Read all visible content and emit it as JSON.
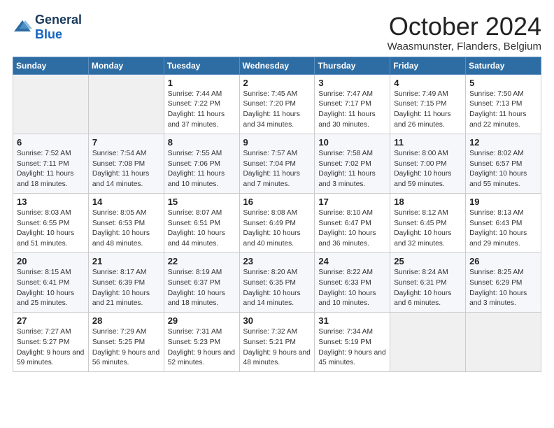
{
  "header": {
    "logo_line1": "General",
    "logo_line2": "Blue",
    "month": "October 2024",
    "location": "Waasmunster, Flanders, Belgium"
  },
  "weekdays": [
    "Sunday",
    "Monday",
    "Tuesday",
    "Wednesday",
    "Thursday",
    "Friday",
    "Saturday"
  ],
  "weeks": [
    [
      {
        "day": "",
        "empty": true
      },
      {
        "day": "",
        "empty": true
      },
      {
        "day": "1",
        "sunrise": "7:44 AM",
        "sunset": "7:22 PM",
        "daylight": "11 hours and 37 minutes."
      },
      {
        "day": "2",
        "sunrise": "7:45 AM",
        "sunset": "7:20 PM",
        "daylight": "11 hours and 34 minutes."
      },
      {
        "day": "3",
        "sunrise": "7:47 AM",
        "sunset": "7:17 PM",
        "daylight": "11 hours and 30 minutes."
      },
      {
        "day": "4",
        "sunrise": "7:49 AM",
        "sunset": "7:15 PM",
        "daylight": "11 hours and 26 minutes."
      },
      {
        "day": "5",
        "sunrise": "7:50 AM",
        "sunset": "7:13 PM",
        "daylight": "11 hours and 22 minutes."
      }
    ],
    [
      {
        "day": "6",
        "sunrise": "7:52 AM",
        "sunset": "7:11 PM",
        "daylight": "11 hours and 18 minutes."
      },
      {
        "day": "7",
        "sunrise": "7:54 AM",
        "sunset": "7:08 PM",
        "daylight": "11 hours and 14 minutes."
      },
      {
        "day": "8",
        "sunrise": "7:55 AM",
        "sunset": "7:06 PM",
        "daylight": "11 hours and 10 minutes."
      },
      {
        "day": "9",
        "sunrise": "7:57 AM",
        "sunset": "7:04 PM",
        "daylight": "11 hours and 7 minutes."
      },
      {
        "day": "10",
        "sunrise": "7:58 AM",
        "sunset": "7:02 PM",
        "daylight": "11 hours and 3 minutes."
      },
      {
        "day": "11",
        "sunrise": "8:00 AM",
        "sunset": "7:00 PM",
        "daylight": "10 hours and 59 minutes."
      },
      {
        "day": "12",
        "sunrise": "8:02 AM",
        "sunset": "6:57 PM",
        "daylight": "10 hours and 55 minutes."
      }
    ],
    [
      {
        "day": "13",
        "sunrise": "8:03 AM",
        "sunset": "6:55 PM",
        "daylight": "10 hours and 51 minutes."
      },
      {
        "day": "14",
        "sunrise": "8:05 AM",
        "sunset": "6:53 PM",
        "daylight": "10 hours and 48 minutes."
      },
      {
        "day": "15",
        "sunrise": "8:07 AM",
        "sunset": "6:51 PM",
        "daylight": "10 hours and 44 minutes."
      },
      {
        "day": "16",
        "sunrise": "8:08 AM",
        "sunset": "6:49 PM",
        "daylight": "10 hours and 40 minutes."
      },
      {
        "day": "17",
        "sunrise": "8:10 AM",
        "sunset": "6:47 PM",
        "daylight": "10 hours and 36 minutes."
      },
      {
        "day": "18",
        "sunrise": "8:12 AM",
        "sunset": "6:45 PM",
        "daylight": "10 hours and 32 minutes."
      },
      {
        "day": "19",
        "sunrise": "8:13 AM",
        "sunset": "6:43 PM",
        "daylight": "10 hours and 29 minutes."
      }
    ],
    [
      {
        "day": "20",
        "sunrise": "8:15 AM",
        "sunset": "6:41 PM",
        "daylight": "10 hours and 25 minutes."
      },
      {
        "day": "21",
        "sunrise": "8:17 AM",
        "sunset": "6:39 PM",
        "daylight": "10 hours and 21 minutes."
      },
      {
        "day": "22",
        "sunrise": "8:19 AM",
        "sunset": "6:37 PM",
        "daylight": "10 hours and 18 minutes."
      },
      {
        "day": "23",
        "sunrise": "8:20 AM",
        "sunset": "6:35 PM",
        "daylight": "10 hours and 14 minutes."
      },
      {
        "day": "24",
        "sunrise": "8:22 AM",
        "sunset": "6:33 PM",
        "daylight": "10 hours and 10 minutes."
      },
      {
        "day": "25",
        "sunrise": "8:24 AM",
        "sunset": "6:31 PM",
        "daylight": "10 hours and 6 minutes."
      },
      {
        "day": "26",
        "sunrise": "8:25 AM",
        "sunset": "6:29 PM",
        "daylight": "10 hours and 3 minutes."
      }
    ],
    [
      {
        "day": "27",
        "sunrise": "7:27 AM",
        "sunset": "5:27 PM",
        "daylight": "9 hours and 59 minutes."
      },
      {
        "day": "28",
        "sunrise": "7:29 AM",
        "sunset": "5:25 PM",
        "daylight": "9 hours and 56 minutes."
      },
      {
        "day": "29",
        "sunrise": "7:31 AM",
        "sunset": "5:23 PM",
        "daylight": "9 hours and 52 minutes."
      },
      {
        "day": "30",
        "sunrise": "7:32 AM",
        "sunset": "5:21 PM",
        "daylight": "9 hours and 48 minutes."
      },
      {
        "day": "31",
        "sunrise": "7:34 AM",
        "sunset": "5:19 PM",
        "daylight": "9 hours and 45 minutes."
      },
      {
        "day": "",
        "empty": true
      },
      {
        "day": "",
        "empty": true
      }
    ]
  ]
}
